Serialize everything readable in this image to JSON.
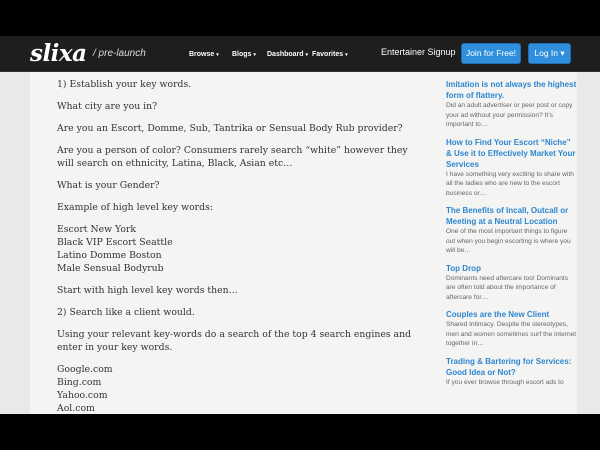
{
  "nav": {
    "logo": "slixa",
    "logo_sub": "/ pre-launch",
    "links": [
      {
        "label": "Browse",
        "caret": "▾"
      },
      {
        "label": "Blogs",
        "caret": "▾"
      },
      {
        "label": "Dashboard",
        "caret": "▾"
      },
      {
        "label": "Favorites",
        "caret": "▾"
      }
    ],
    "entertainer_signup": "Entertainer Signup",
    "join_label": "Join for Free!",
    "login_label": "Log In ▾"
  },
  "article": {
    "paragraphs": [
      "1) Establish your key words.",
      "What city are you in?",
      "Are you an Escort, Domme, Sub, Tantrika or Sensual Body Rub provider?",
      "Are you a person of color? Consumers rarely search “white” however they will search on ethnicity, Latina, Black, Asian etc…",
      "What is your Gender?",
      "Example of high level key words:"
    ],
    "keywords": [
      "Escort New York",
      "Black VIP Escort Seattle",
      "Latino Domme Boston",
      "Male Sensual Bodyrub"
    ],
    "after_keywords": [
      "Start with high level key words then…",
      "2) Search like a client would.",
      "Using your relevant key-words do a search of the top 4 search engines and enter in your key words."
    ],
    "engines": [
      "Google.com",
      "Bing.com",
      "Yahoo.com",
      "Aol.com"
    ]
  },
  "sidebar": [
    {
      "title": "Imitation is not always the highest form of flattery.",
      "text": "Did an adult advertiser or peer post or copy your ad without your permission? It’s important to…"
    },
    {
      "title": "How to Find Your Escort “Niche” & Use it to Effectively Market Your Services",
      "text": "I have something very exciting to share with all the ladies who are new to the escort business or…"
    },
    {
      "title": "The Benefits of Incall, Outcall or Meeting at a Neutral Location",
      "text": "One of the most important things to figure out when you begin escorting is where you will be…"
    },
    {
      "title": "Top Drop",
      "text": "Dominants need aftercare too! Dominants are often told about the importance of aftercare for…"
    },
    {
      "title": "Couples are the New Client",
      "text": "Shared Intimacy. Despite the stereotypes, men and women sometimes surf the internet together in…"
    },
    {
      "title": "Trading & Bartering for Services: Good Idea or Not?",
      "text": "If you ever browse through escort ads to"
    }
  ]
}
